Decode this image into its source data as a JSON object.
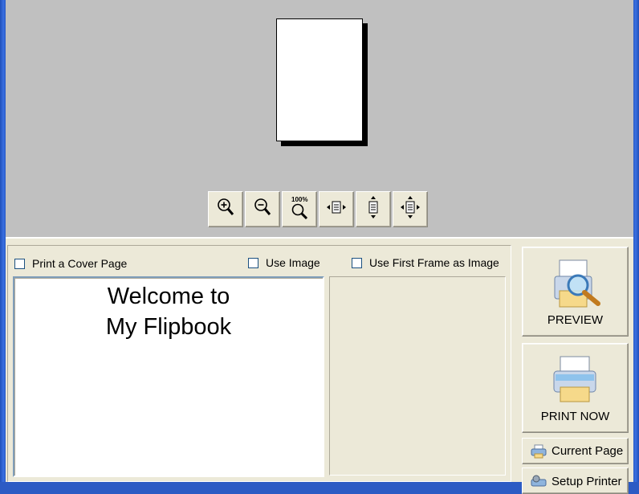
{
  "preview": {
    "zoom_tools": [
      {
        "name": "zoom-in-icon"
      },
      {
        "name": "zoom-out-icon"
      },
      {
        "name": "zoom-100-icon",
        "label": "100%"
      },
      {
        "name": "fit-width-icon"
      },
      {
        "name": "fit-height-icon"
      },
      {
        "name": "fit-page-icon"
      }
    ]
  },
  "options": {
    "print_cover_label": "Print a Cover Page",
    "use_image_label": "Use Image",
    "use_first_frame_label": "Use First Frame as Image",
    "print_cover_checked": false,
    "use_image_checked": false,
    "use_first_frame_checked": false,
    "cover_text": "Welcome to\nMy Flipbook"
  },
  "actions": {
    "preview_label": "PREVIEW",
    "print_now_label": "PRINT NOW",
    "current_page_label": "Current Page",
    "setup_printer_label": "Setup Printer"
  },
  "colors": {
    "window_frame": "#2c5bc4",
    "preview_background": "#c0c0c0",
    "panel_background": "#ece9d8"
  }
}
